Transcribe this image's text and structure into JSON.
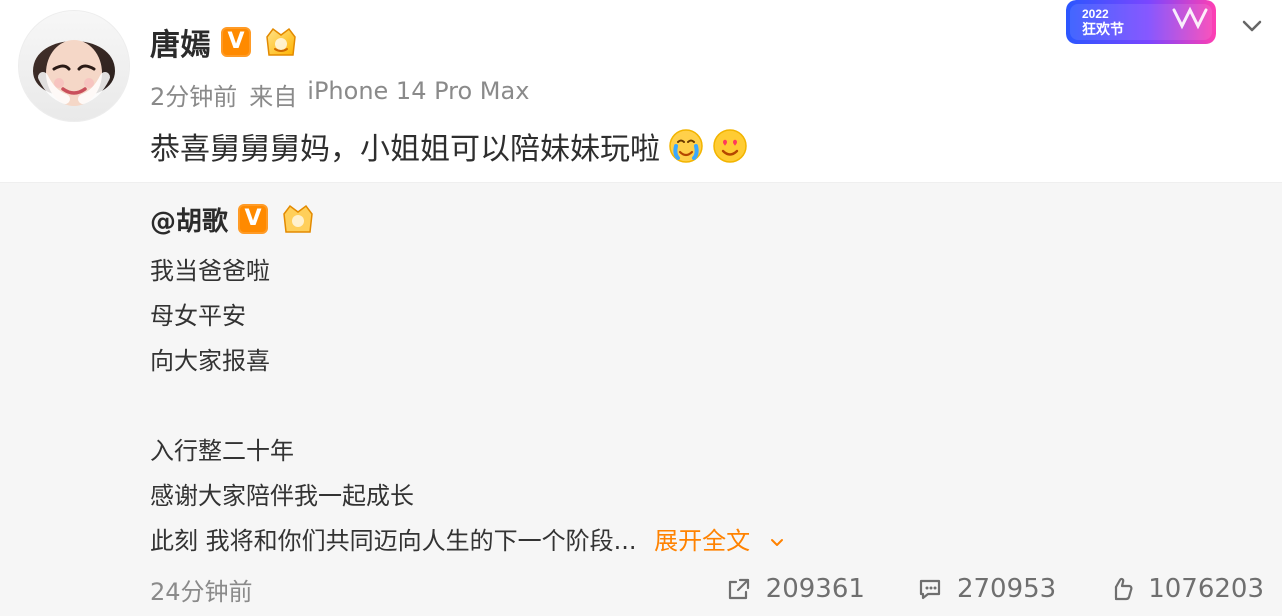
{
  "post": {
    "author": {
      "name": "唐嫣"
    },
    "meta": {
      "time": "2分钟前",
      "source_prefix": "来自",
      "device": "iPhone 14 Pro Max"
    },
    "text": "恭喜舅舅舅妈，小姐姐可以陪妹妹玩啦"
  },
  "banner": {
    "event_text": "2022",
    "event_label": "狂欢节"
  },
  "repost": {
    "author": "@胡歌",
    "lines": [
      "我当爸爸啦",
      "母女平安",
      "向大家报喜",
      "",
      "入行整二十年",
      "感谢大家陪伴我一起成长",
      "此刻 我将和你们共同迈向人生的下一个阶段..."
    ],
    "expand_text": "展开全文",
    "time": "24分钟前"
  },
  "stats": {
    "share": "209361",
    "comments": "270953",
    "likes": "1076203"
  },
  "colors": {
    "verified": "#ff8a00",
    "link": "#ff8200",
    "repost_bg": "#f6f6f6",
    "meta_gray": "#8a8a8a"
  }
}
